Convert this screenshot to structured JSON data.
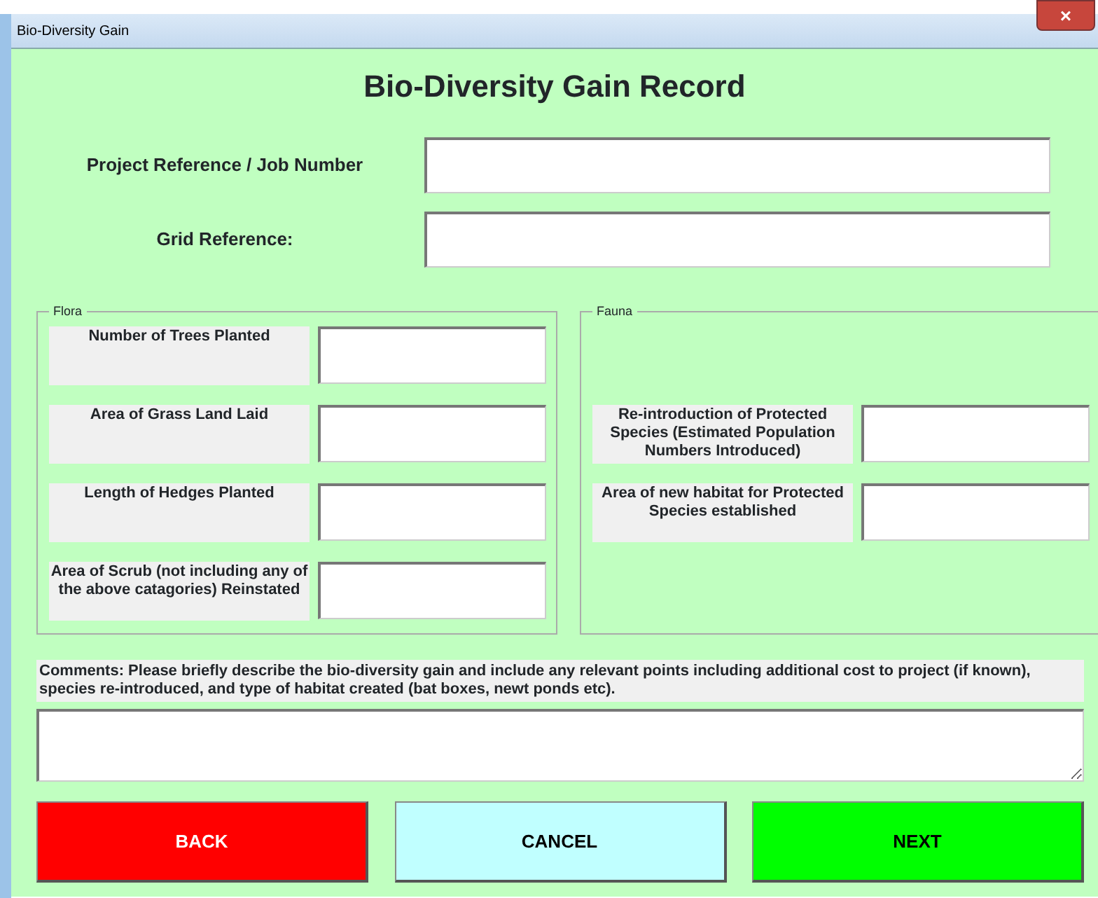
{
  "window": {
    "title": "Bio-Diversity Gain",
    "close": "×"
  },
  "heading": "Bio-Diversity Gain Record",
  "top_fields": [
    {
      "label": "Project Reference / Job Number"
    },
    {
      "label": "Grid Reference:"
    }
  ],
  "flora": {
    "legend": "Flora",
    "fields": [
      {
        "label": "Number of Trees Planted"
      },
      {
        "label": "Area of Grass Land Laid"
      },
      {
        "label": "Length of Hedges Planted"
      },
      {
        "label": "Area of Scrub (not including any of the above catagories) Reinstated"
      }
    ]
  },
  "fauna": {
    "legend": "Fauna",
    "fields": [
      {
        "label": "Re-introduction of Protected Species (Estimated Population Numbers Introduced)"
      },
      {
        "label": "Area of new habitat for Protected Species established"
      }
    ]
  },
  "comments": {
    "label": "Comments: Please briefly describe the bio-diversity gain and include any relevant points including additional cost to project (if known), species re-introduced, and type of habitat created (bat boxes, newt ponds etc)."
  },
  "buttons": [
    {
      "label": "BACK",
      "color": "#ff0000"
    },
    {
      "label": "CANCEL",
      "color": "#c0ffff"
    },
    {
      "label": "NEXT",
      "color": "#00ff00"
    }
  ]
}
